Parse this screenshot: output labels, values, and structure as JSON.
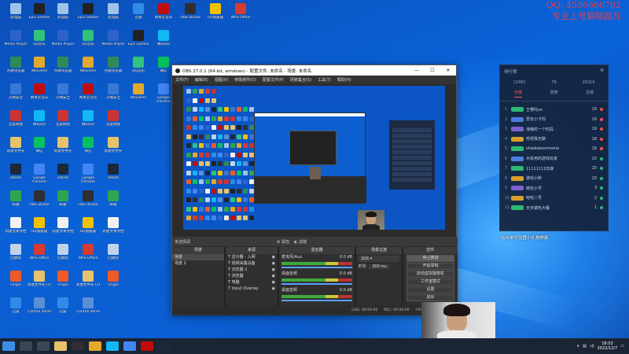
{
  "desktop": {
    "icons": [
      {
        "label": "此电脑",
        "color": "#9fc3e8"
      },
      {
        "label": "Media Player",
        "color": "#2d63c8"
      },
      {
        "label": "谷歌浏览器",
        "color": "#2e8b57"
      },
      {
        "label": "火绒安全",
        "color": "#3a78d6"
      },
      {
        "label": "百度网盘",
        "color": "#cc3333"
      },
      {
        "label": "新建文件夹",
        "color": "#e6c36a"
      },
      {
        "label": "Steam",
        "color": "#1b2838"
      },
      {
        "label": "邮箱",
        "color": "#2ea44f"
      },
      {
        "label": "新建文本文档",
        "color": "#f2f2f2"
      },
      {
        "label": "回收站",
        "color": "#bfd3ea"
      },
      {
        "label": "Origin",
        "color": "#f05a28"
      },
      {
        "label": "迅雷",
        "color": "#2f8be6"
      },
      {
        "label": "Epic Games",
        "color": "#222222"
      },
      {
        "label": "QQ音乐",
        "color": "#31c27c"
      },
      {
        "label": "WeGame",
        "color": "#e3a92b"
      },
      {
        "label": "网易云音乐",
        "color": "#c20c0c"
      },
      {
        "label": "腾讯QQ",
        "color": "#12b7f5"
      },
      {
        "label": "微信",
        "color": "#07c160"
      },
      {
        "label": "Google Chrome",
        "color": "#4285f4"
      },
      {
        "label": "OBS Studio",
        "color": "#302e31"
      },
      {
        "label": "UU加速器",
        "color": "#f2c200"
      },
      {
        "label": "WPS Office",
        "color": "#d63b2f"
      },
      {
        "label": "新建文件夹 (2)",
        "color": "#e6c36a"
      },
      {
        "label": "Control Panel",
        "color": "#5a8fd6"
      }
    ]
  },
  "watermark": {
    "line1": "QQ: 4536666702",
    "line2": "专业上号解除超凡"
  },
  "obs": {
    "title": "OBS 27.0.1 (64-bit, windows) - 配置文件: 未命名 - 场景: 未命名",
    "menu": [
      "文件(F)",
      "编辑(E)",
      "视图(V)",
      "停靠部件(D)",
      "配置文件(P)",
      "场景集合(S)",
      "工具(T)",
      "帮助(H)"
    ],
    "source_bar": {
      "left": "未选择源",
      "props": "属性",
      "filters": "滤镜"
    },
    "docks": {
      "scenes": {
        "header": "场景",
        "items": [
          "场景",
          "场景 2"
        ]
      },
      "sources": {
        "header": "来源",
        "items": [
          "显示器 - 入网",
          "视频采集设备",
          "浏览器 2",
          "浏览器",
          "电脑",
          "Input Overlay"
        ]
      },
      "mixer": {
        "header": "混音器",
        "channels": [
          {
            "name": "麦克风/Aux",
            "db": "0.0 dB"
          },
          {
            "name": "桌面音频",
            "db": "0.0 dB"
          },
          {
            "name": "桌面音频",
            "db": "0.0 dB"
          }
        ]
      },
      "transitions": {
        "header": "场景过渡",
        "type": "淡出",
        "duration_label": "时长",
        "duration": "300 ms"
      },
      "controls": {
        "header": "控件",
        "buttons": [
          "停止推流",
          "开始录制",
          "启动虚拟摄像机",
          "工作室模式",
          "设置",
          "退出"
        ]
      }
    },
    "status": {
      "live": "LIVE: 00:00:00",
      "rec": "REC: 00:00:00",
      "cpu": "CPU: 5.7%, 60.00 fps"
    }
  },
  "rank_panel": {
    "title": "排行榜",
    "stats": [
      {
        "label": "12482"
      },
      {
        "label": "78"
      },
      {
        "label": "28316"
      }
    ],
    "tabs": [
      "日榜",
      "周榜",
      "总榜"
    ],
    "rows": [
      {
        "num": "1",
        "name": "王哪吒oo",
        "score": "19",
        "badge": "#2eb872",
        "dot": "#ff4d4d"
      },
      {
        "num": "2",
        "name": "爱玩小卡玛",
        "score": "19",
        "badge": "#4c7de0",
        "dot": "#ff4d4d"
      },
      {
        "num": "3",
        "name": "滑稽的一个时段",
        "score": "19",
        "badge": "#7b61d1",
        "dot": "#ff4d4d"
      },
      {
        "num": "4",
        "name": "哎呀我无聊",
        "score": "18",
        "badge": "#d6a02c",
        "dot": "#ff4d4d"
      },
      {
        "num": "5",
        "name": "shadowsomeone",
        "score": "18",
        "badge": "#2eb872",
        "dot": "#ff4d4d"
      },
      {
        "num": "6",
        "name": "木有用的游戏玩家",
        "score": "10",
        "badge": "#4c7de0",
        "dot": "#2eb872"
      },
      {
        "num": "7",
        "name": "11111111玩家",
        "score": "10",
        "badge": "#2eb872",
        "dot": "#2eb872"
      },
      {
        "num": "8",
        "name": "游戏小胖",
        "score": "10",
        "badge": "#d6a02c",
        "dot": "#2eb872"
      },
      {
        "num": "9",
        "name": "微信小号",
        "score": "3",
        "badge": "#7b61d1",
        "dot": "#2eb872"
      },
      {
        "num": "10",
        "name": "哈哈二号",
        "score": "2",
        "badge": "#d6a02c",
        "dot": "#2eb872"
      },
      {
        "num": "11",
        "name": "天天做吃大餐",
        "score": "1",
        "badge": "#2eb872",
        "dot": "#2eb872"
      }
    ],
    "tip": "点击单可设置小礼物屏蔽"
  },
  "taskbar": {
    "apps": [
      {
        "name": "start-icon",
        "color": "#3c8ee8"
      },
      {
        "name": "search-icon",
        "color": "#3a4658"
      },
      {
        "name": "task-view-icon",
        "color": "#3a4658"
      },
      {
        "name": "file-explorer-icon",
        "color": "#e6c36a"
      },
      {
        "name": "obs-icon",
        "color": "#302e31"
      },
      {
        "name": "wegame-icon",
        "color": "#e3a92b"
      },
      {
        "name": "qq-icon",
        "color": "#12b7f5"
      },
      {
        "name": "chrome-icon",
        "color": "#4285f4"
      },
      {
        "name": "netease-icon",
        "color": "#c20c0c"
      },
      {
        "name": "steam-icon",
        "color": "#1b2838"
      }
    ],
    "time": "18:03",
    "date": "2022/12/7"
  }
}
